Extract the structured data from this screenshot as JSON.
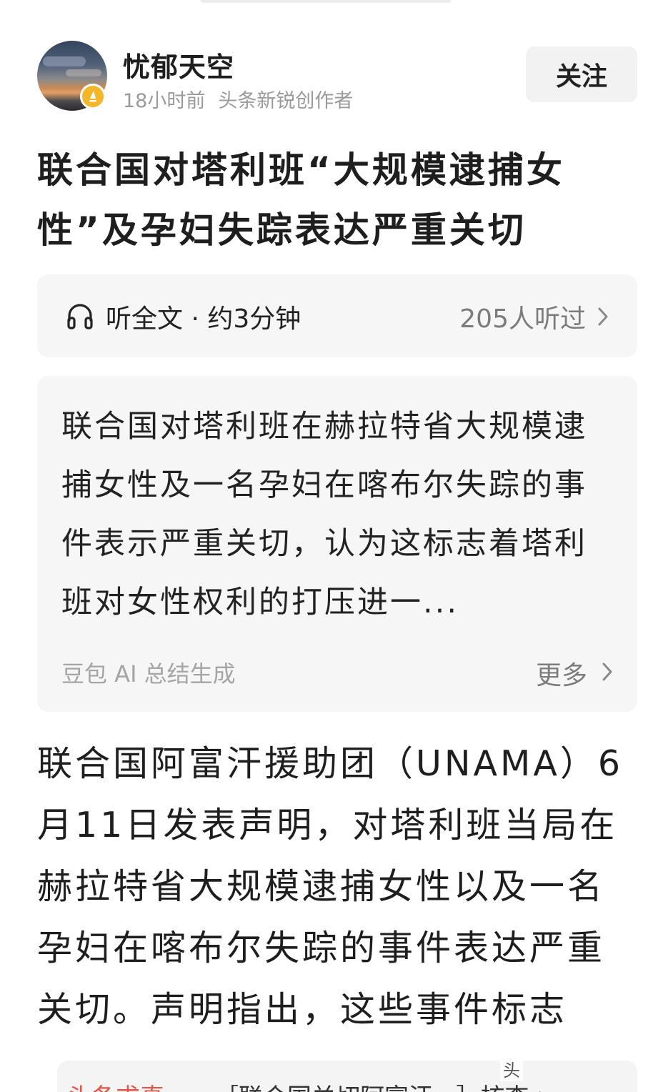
{
  "author": {
    "name": "忧郁天空",
    "time": "18小时前",
    "tag": "头条新锐创作者",
    "follow_label": "关注"
  },
  "article": {
    "title": "联合国对塔利班“大规模逮捕女性”及孕妇失踪表达严重关切"
  },
  "listen": {
    "label": "听全文 · 约3分钟",
    "count": "205人听过"
  },
  "summary": {
    "text": "联合国对塔利班在赫拉特省大规模逮捕女性及一名孕妇在喀布尔失踪的事件表示严重关切，认为这标志着塔利班对女性权利的打压进一...",
    "source": "豆包 AI 总结生成",
    "more_label": "更多"
  },
  "body": {
    "text": "联合国阿富汗援助团（UNAMA）6月11日发表声明，对塔利班当局在赫拉特省大规模逮捕女性以及一名孕妇在喀布尔失踪的事件表达严重关切。声明指出，这些事件标志"
  },
  "recommend": {
    "tag": "头条求真",
    "text": "［联合国关切阿富汗...］核查 >"
  },
  "watermark": "头"
}
